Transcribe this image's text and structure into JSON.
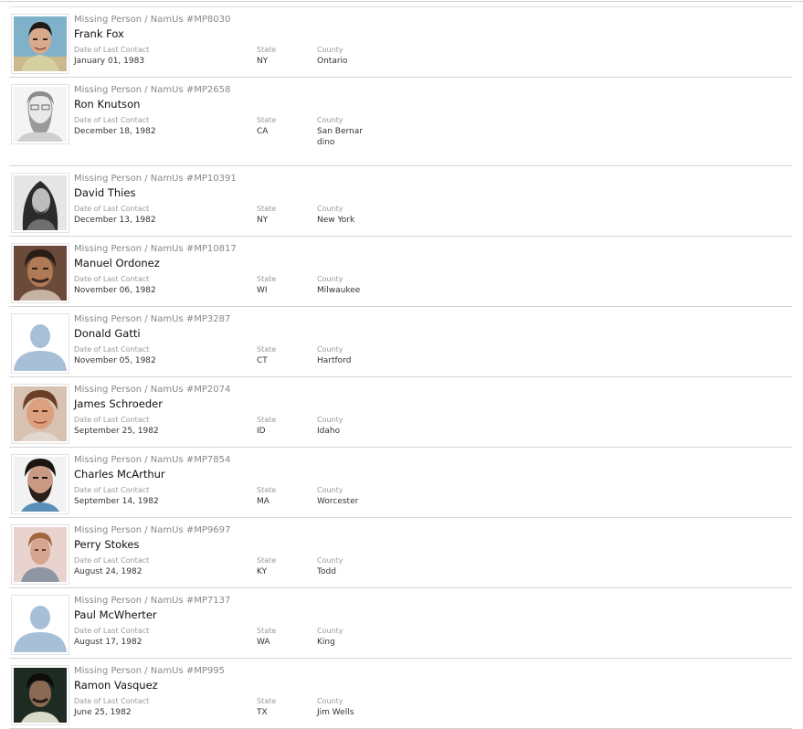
{
  "labels": {
    "date": "Date of Last Contact",
    "state": "State",
    "county": "County"
  },
  "records": [
    {
      "kicker": "Missing Person / NamUs #MP8030",
      "name": "Frank Fox",
      "date": "January 01, 1983",
      "state": "NY",
      "county": "Ontario",
      "photo": "color-photo"
    },
    {
      "kicker": "Missing Person / NamUs #MP2658",
      "name": "Ron Knutson",
      "date": "December 18, 1982",
      "state": "CA",
      "county": "San Bernardino",
      "photo": "sketch"
    },
    {
      "kicker": "Missing Person / NamUs #MP10391",
      "name": "David Thies",
      "date": "December 13, 1982",
      "state": "NY",
      "county": "New York",
      "photo": "bw-photo"
    },
    {
      "kicker": "Missing Person / NamUs #MP10817",
      "name": "Manuel Ordonez",
      "date": "November 06, 1982",
      "state": "WI",
      "county": "Milwaukee",
      "photo": "color-photo"
    },
    {
      "kicker": "Missing Person / NamUs #MP3287",
      "name": "Donald Gatti",
      "date": "November 05, 1982",
      "state": "CT",
      "county": "Hartford",
      "photo": "placeholder"
    },
    {
      "kicker": "Missing Person / NamUs #MP2074",
      "name": "James Schroeder",
      "date": "September 25, 1982",
      "state": "ID",
      "county": "Idaho",
      "photo": "color-photo"
    },
    {
      "kicker": "Missing Person / NamUs #MP7854",
      "name": "Charles McArthur",
      "date": "September 14, 1982",
      "state": "MA",
      "county": "Worcester",
      "photo": "color-photo"
    },
    {
      "kicker": "Missing Person / NamUs #MP9697",
      "name": "Perry Stokes",
      "date": "August 24, 1982",
      "state": "KY",
      "county": "Todd",
      "photo": "color-photo"
    },
    {
      "kicker": "Missing Person / NamUs #MP7137",
      "name": "Paul McWherter",
      "date": "August 17, 1982",
      "state": "WA",
      "county": "King",
      "photo": "placeholder"
    },
    {
      "kicker": "Missing Person / NamUs #MP995",
      "name": "Ramon Vasquez",
      "date": "June 25, 1982",
      "state": "TX",
      "county": "Jim Wells",
      "photo": "color-photo"
    }
  ]
}
